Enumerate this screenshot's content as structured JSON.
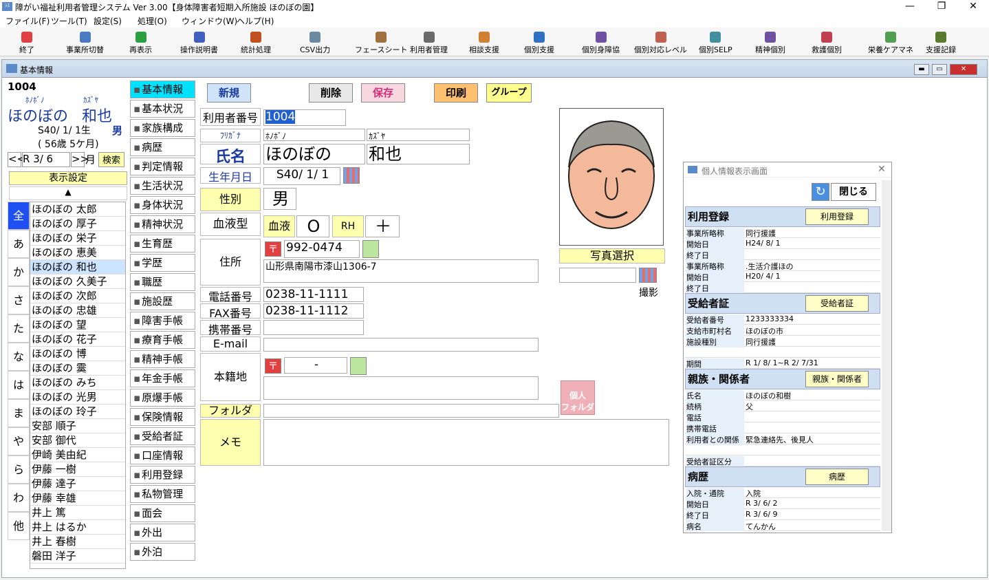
{
  "window": {
    "title": "障がい福祉利用者管理システム Ver 3.00【身体障害者短期入所施設 ほのぼの園】",
    "min": "—",
    "max": "❐",
    "close": "✕"
  },
  "menu": [
    "ファイル(F)",
    "ツール(T)",
    "設定(S)",
    "処理(O)",
    "ウィンドウ(W)",
    "ヘルプ(H)"
  ],
  "toolbar": [
    {
      "label": "終了",
      "icon": "close-icon",
      "color": "#e04040"
    },
    {
      "label": "事業所切替",
      "icon": "office-icon",
      "color": "#4a7ac0"
    },
    {
      "label": "再表示",
      "icon": "refresh-icon",
      "color": "#2aa040"
    },
    {
      "label": "操作説明書",
      "icon": "help-icon",
      "color": "#4060c0"
    },
    {
      "label": "統計処理",
      "icon": "chart-icon",
      "color": "#c05020"
    },
    {
      "label": "CSV出力",
      "icon": "csv-icon",
      "color": "#6a8aa0"
    },
    {
      "label": "フェースシート",
      "icon": "face-icon",
      "color": "#a07040"
    },
    {
      "label": "利用者管理",
      "icon": "book-icon",
      "color": "#6a6a6a"
    },
    {
      "label": "相談支援",
      "icon": "consult-icon",
      "color": "#d08030"
    },
    {
      "label": "個別支援",
      "icon": "edit-icon",
      "color": "#3070c0"
    },
    {
      "label": "個別身障協",
      "icon": "person-icon",
      "color": "#7050a0"
    },
    {
      "label": "個別対応レベル",
      "icon": "level-icon",
      "color": "#c06050"
    },
    {
      "label": "個別SELP",
      "icon": "selp-icon",
      "color": "#4090a0"
    },
    {
      "label": "精神個別",
      "icon": "mental-icon",
      "color": "#7050a0"
    },
    {
      "label": "救護個別",
      "icon": "rescue-icon",
      "color": "#c04050"
    },
    {
      "label": "栄養ケアマネ",
      "icon": "nutrition-icon",
      "color": "#50a050"
    },
    {
      "label": "支援記録",
      "icon": "record-icon",
      "color": "#5a7a30"
    }
  ],
  "child": {
    "title": "基本情報",
    "min": "▬",
    "max": "▭",
    "close": "✕"
  },
  "left": {
    "id": "1004",
    "kana_last": "ﾎﾉﾎﾞﾉ",
    "kana_first": "ｶｽﾞﾔ",
    "last": "ほのぼの",
    "first": "和也",
    "birth": "S40/ 1/ 1生",
    "sex": "男",
    "age": "( 56歳 5ケ月)",
    "prev": "<<",
    "date": "R 3/ 6",
    "next": ">>",
    "month": "月",
    "search": "検索",
    "display": "表示設定",
    "up": "▲"
  },
  "alpha": [
    "全",
    "あ",
    "か",
    "さ",
    "た",
    "な",
    "は",
    "ま",
    "や",
    "ら",
    "わ",
    "他"
  ],
  "names": [
    "ほのぼの 太郎",
    "ほのぼの 厚子",
    "ほのぼの 栄子",
    "ほのぼの 恵美",
    "ほのぼの 和也",
    "ほのぼの 久美子",
    "ほのぼの 次郎",
    "ほのぼの 忠雄",
    "ほのぼの 望",
    "ほのぼの 花子",
    "ほのぼの 博",
    "ほのぼの 霙",
    "ほのぼの みち",
    "ほのぼの 光男",
    "ほのぼの 玲子",
    "安部 順子",
    "安部 御代",
    "伊崎 美由紀",
    "伊藤 一樹",
    "伊藤 達子",
    "伊藤 幸雄",
    "井上 篤",
    "井上 はるか",
    "井上 春樹",
    "磐田 洋子"
  ],
  "tabs": [
    "基本情報",
    "基本状況",
    "家族構成",
    "病歴",
    "判定情報",
    "生活状況",
    "身体状況",
    "精神状況",
    "生育歴",
    "学歴",
    "職歴",
    "施設歴",
    "障害手帳",
    "療育手帳",
    "精神手帳",
    "年金手帳",
    "原爆手帳",
    "保険情報",
    "受給者証",
    "口座情報",
    "利用登録",
    "私物管理",
    "面会",
    "外出",
    "外泊"
  ],
  "buttons": {
    "new": "新規",
    "delete": "削除",
    "save": "保存",
    "print": "印刷",
    "group": "グループ"
  },
  "form": {
    "id_label": "利用者番号",
    "id_value": "1004",
    "furigana_label": "ﾌﾘｶﾞﾅ",
    "kana_last": "ﾎﾉﾎﾞﾉ",
    "kana_first": "ｶｽﾞﾔ",
    "name_label": "氏名",
    "last": "ほのぼの",
    "first": "和也",
    "birth_label": "生年月日",
    "birth": "S40/ 1/ 1",
    "sex_label": "性別",
    "sex": "男",
    "blood_label": "血液型",
    "blood_btn": "血液",
    "blood": "O",
    "rh_btn": "RH",
    "rh": "＋",
    "addr_label": "住所",
    "postal_mark": "〒",
    "postal": "992-0474",
    "address": "山形県南陽市漆山1306-7",
    "tel_label": "電話番号",
    "tel": "0238-11-1111",
    "fax_label": "FAX番号",
    "fax": "0238-11-1112",
    "mobile_label": "携帯番号",
    "mobile": "",
    "email_label": "E-mail",
    "email": "",
    "honseki_label": "本籍地",
    "honseki_postal": "-",
    "folder_label": "フォルダ",
    "memo_label": "メモ",
    "photo_select": "写真選択",
    "photo_take": "撮影",
    "personal_folder": "個人\nフォルダ"
  },
  "popup": {
    "title": "個人情報表示画面",
    "close_btn": "閉じる",
    "sections": [
      {
        "title": "利用登録",
        "button": "利用登録",
        "rows": [
          [
            "事業所略称",
            "同行援護"
          ],
          [
            "開始日",
            "H24/ 8/ 1"
          ],
          [
            "終了日",
            ""
          ],
          [
            "事業所略称",
            ".生活介護ほの"
          ],
          [
            "開始日",
            "H20/ 4/ 1"
          ],
          [
            "終了日",
            ""
          ]
        ]
      },
      {
        "title": "受給者証",
        "button": "受給者証",
        "rows": [
          [
            "受給者番号",
            "1233333334"
          ],
          [
            "支給市町村名",
            "ほのぼの市"
          ],
          [
            "施設種別",
            "同行援護"
          ],
          [
            "",
            ""
          ],
          [
            "期間",
            "R 1/ 8/ 1~R 2/ 7/31"
          ]
        ]
      },
      {
        "title": "親族・関係者",
        "button": "親族・関係者",
        "rows": [
          [
            "氏名",
            "ほのぼの和樹"
          ],
          [
            "続柄",
            "父"
          ],
          [
            "電話",
            ""
          ],
          [
            "携帯電話",
            ""
          ],
          [
            "利用者との関係",
            "緊急連絡先、後見人"
          ],
          [
            "",
            ""
          ],
          [
            "受給者証区分",
            ""
          ]
        ]
      },
      {
        "title": "病歴",
        "button": "病歴",
        "rows": [
          [
            "入院・通院",
            "入院"
          ],
          [
            "開始日",
            "R 3/ 6/ 2"
          ],
          [
            "終了日",
            "R 3/ 6/ 9"
          ],
          [
            "病名",
            "てんかん"
          ]
        ]
      }
    ]
  }
}
